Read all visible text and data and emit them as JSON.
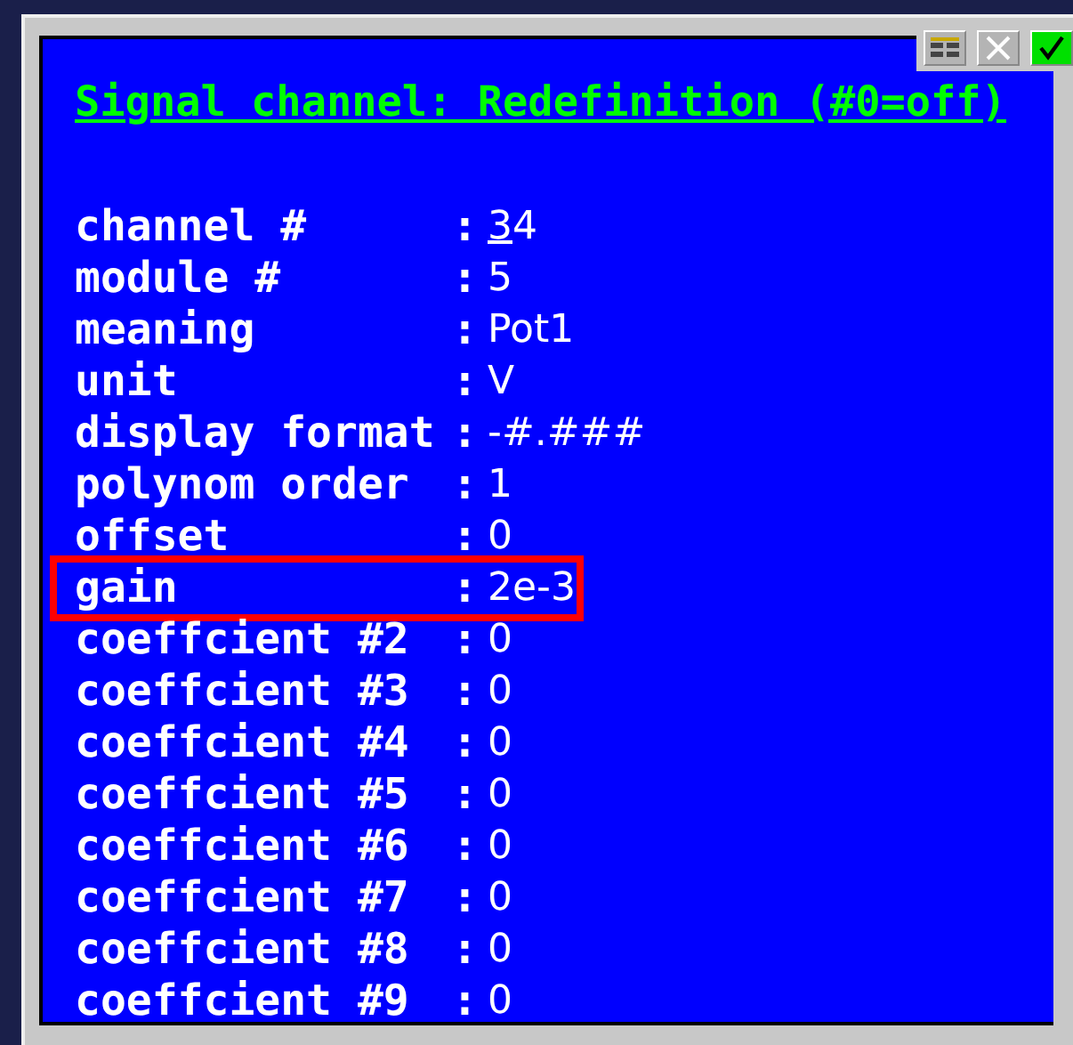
{
  "window": {
    "title": "Signal channel: Redefinition (#0=off)",
    "buttons": [
      {
        "kind": "table"
      },
      {
        "kind": "close"
      },
      {
        "kind": "ok"
      }
    ]
  },
  "fields": [
    {
      "label": "channel #",
      "separator": ":",
      "value": "34",
      "editing": true,
      "highlight": false
    },
    {
      "label": "module #",
      "separator": ":",
      "value": "5",
      "editing": false,
      "highlight": false
    },
    {
      "label": "meaning",
      "separator": ":",
      "value": "Pot1",
      "editing": false,
      "highlight": false
    },
    {
      "label": "unit",
      "separator": ":",
      "value": "V",
      "editing": false,
      "highlight": false
    },
    {
      "label": "display format",
      "separator": ":",
      "value": "-#.###",
      "editing": false,
      "highlight": false
    },
    {
      "label": "polynom order",
      "separator": ":",
      "value": "1",
      "editing": false,
      "highlight": false
    },
    {
      "label": "offset",
      "separator": ":",
      "value": "0",
      "editing": false,
      "highlight": false
    },
    {
      "label": "gain",
      "separator": ":",
      "value": "2e-3",
      "editing": false,
      "highlight": true
    },
    {
      "label": "coeffcient #2",
      "separator": ":",
      "value": "0",
      "editing": false,
      "highlight": false
    },
    {
      "label": "coeffcient #3",
      "separator": ":",
      "value": "0",
      "editing": false,
      "highlight": false
    },
    {
      "label": "coeffcient #4",
      "separator": ":",
      "value": "0",
      "editing": false,
      "highlight": false
    },
    {
      "label": "coeffcient #5",
      "separator": ":",
      "value": "0",
      "editing": false,
      "highlight": false
    },
    {
      "label": "coeffcient #6",
      "separator": ":",
      "value": "0",
      "editing": false,
      "highlight": false
    },
    {
      "label": "coeffcient #7",
      "separator": ":",
      "value": "0",
      "editing": false,
      "highlight": false
    },
    {
      "label": "coeffcient #8",
      "separator": ":",
      "value": "0",
      "editing": false,
      "highlight": false
    },
    {
      "label": "coeffcient #9",
      "separator": ":",
      "value": "0",
      "editing": false,
      "highlight": false
    }
  ]
}
